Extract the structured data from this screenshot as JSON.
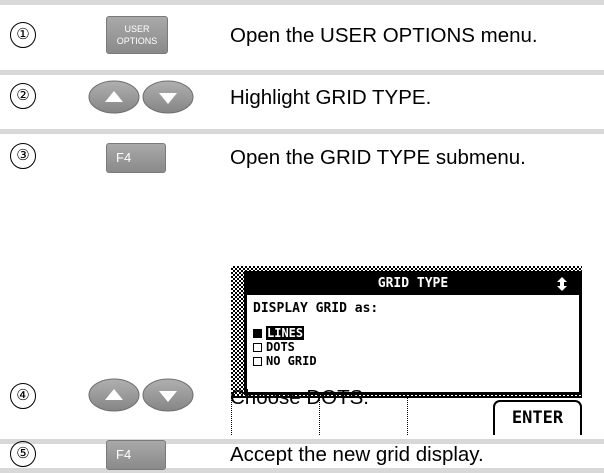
{
  "steps": [
    {
      "num": "①",
      "key": "user-options",
      "text": "Open the USER OPTIONS menu."
    },
    {
      "num": "②",
      "key": "arrows",
      "text": "Highlight GRID TYPE."
    },
    {
      "num": "③",
      "key": "F4",
      "text": "Open the GRID TYPE submenu."
    },
    {
      "num": "④",
      "key": "arrows",
      "text": "Choose DOTS."
    },
    {
      "num": "⑤",
      "key": "F4",
      "text": "Accept the new grid display."
    }
  ],
  "keys": {
    "user_line1": "USER",
    "user_line2": "OPTIONS",
    "f4": "F4"
  },
  "screen": {
    "title": "GRID TYPE",
    "prompt": "DISPLAY GRID as:",
    "options": [
      {
        "label": "LINES",
        "checked": true,
        "highlighted": true
      },
      {
        "label": "DOTS",
        "checked": false,
        "highlighted": false
      },
      {
        "label": "NO GRID",
        "checked": false,
        "highlighted": false
      }
    ],
    "softkey": "ENTER"
  },
  "colors": {
    "key_gray": "#9a9a9a",
    "separator": "#d8d8d8",
    "lcd_ink": "#000000"
  }
}
